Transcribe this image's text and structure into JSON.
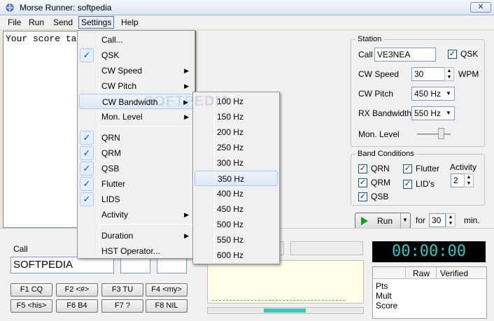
{
  "window": {
    "title": "Morse Runner: softpedia",
    "close": "✕"
  },
  "menubar": [
    "File",
    "Run",
    "Send",
    "Settings",
    "Help"
  ],
  "main_text": "Your score ta",
  "settings_menu": {
    "items": [
      {
        "label": "Call...",
        "checked": false,
        "submenu": false
      },
      {
        "label": "QSK",
        "checked": true,
        "submenu": false
      },
      {
        "label": "CW Speed",
        "checked": false,
        "submenu": true
      },
      {
        "label": "CW Pitch",
        "checked": false,
        "submenu": true
      },
      {
        "label": "CW Bandwidth",
        "checked": false,
        "submenu": true
      },
      {
        "label": "Mon. Level",
        "checked": false,
        "submenu": true
      },
      {
        "label": "QRN",
        "checked": true,
        "submenu": false
      },
      {
        "label": "QRM",
        "checked": true,
        "submenu": false
      },
      {
        "label": "QSB",
        "checked": true,
        "submenu": false
      },
      {
        "label": "Flutter",
        "checked": true,
        "submenu": false
      },
      {
        "label": "LIDS",
        "checked": true,
        "submenu": false
      },
      {
        "label": "Activity",
        "checked": false,
        "submenu": true
      },
      {
        "label": "Duration",
        "checked": false,
        "submenu": true
      },
      {
        "label": "HST Operator...",
        "checked": false,
        "submenu": false
      }
    ]
  },
  "bandwidth_menu": [
    "100 Hz",
    "150 Hz",
    "200 Hz",
    "250 Hz",
    "300 Hz",
    "350 Hz",
    "400 Hz",
    "450 Hz",
    "500 Hz",
    "550 Hz",
    "600 Hz"
  ],
  "watermark": "SOFTPEDIA",
  "station": {
    "title": "Station",
    "call_label": "Call",
    "call_value": "VE3NEA",
    "qsk_label": "QSK",
    "cw_speed_label": "CW Speed",
    "cw_speed_value": "30",
    "wpm_label": "WPM",
    "cw_pitch_label": "CW Pitch",
    "cw_pitch_value": "450 Hz",
    "rx_bw_label": "RX Bandwidth",
    "rx_bw_value": "550 Hz",
    "mon_level_label": "Mon. Level"
  },
  "band": {
    "title": "Band Conditions",
    "qrn": "QRN",
    "qrm": "QRM",
    "qsb": "QSB",
    "flutter": "Flutter",
    "lids": "LID's",
    "activity_label": "Activity",
    "activity_value": "2"
  },
  "run": {
    "label": "Run",
    "for_label": "for",
    "minutes": "30",
    "min_label": "min."
  },
  "call_entry": {
    "label": "Call",
    "value": "SOFTPEDIA"
  },
  "fkeys": [
    "F1  CQ",
    "F2  <#>",
    "F3  TU",
    "F4  <my>",
    "F5  <his>",
    "F6  B4",
    "F7  ?",
    "F8  NIL"
  ],
  "clock": "00:00:00",
  "score": {
    "headers": [
      "Raw",
      "Verified"
    ],
    "rows": [
      "Pts",
      "Mult",
      "Score"
    ]
  },
  "colors": {
    "clock_text": "#2ec8c8",
    "progress": "#3cc8b4",
    "check": "#1f4f8a"
  }
}
